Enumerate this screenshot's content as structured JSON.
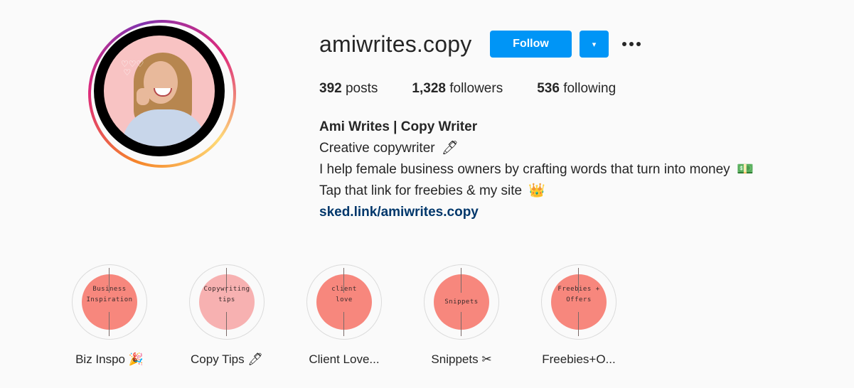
{
  "profile": {
    "username": "amiwrites.copy",
    "follow_label": "Follow",
    "dropdown_icon": "▾",
    "stats": {
      "posts_count": "392",
      "posts_label": "posts",
      "followers_count": "1,328",
      "followers_label": "followers",
      "following_count": "536",
      "following_label": "following"
    },
    "bio": {
      "name": "Ami Writes | Copy Writer",
      "line1": "Creative copywriter",
      "line1_emoji": "🖊",
      "line2": "I help female business owners by crafting words that turn into money",
      "line2_emoji": "💵",
      "line3": "Tap that link for freebies & my site",
      "line3_emoji": "👑",
      "link": "sked.link/amiwrites.copy"
    }
  },
  "highlights": [
    {
      "cover_text_1": "Business",
      "cover_text_2": "Inspiration",
      "label": "Biz Inspo",
      "emoji": "🎉"
    },
    {
      "cover_text_1": "Copywriting",
      "cover_text_2": "tips",
      "label": "Copy Tips",
      "emoji": "🖊"
    },
    {
      "cover_text_1": "client",
      "cover_text_2": "love",
      "label": "Client Love...",
      "emoji": ""
    },
    {
      "cover_text_1": "Snippets",
      "cover_text_2": "",
      "label": "Snippets",
      "emoji": "✂"
    },
    {
      "cover_text_1": "Freebies +",
      "cover_text_2": "Offers",
      "label": "Freebies+O...",
      "emoji": ""
    }
  ],
  "colors": {
    "follow_blue": "#0095f6",
    "link": "#00376b",
    "highlight_cover": "#f7877d"
  }
}
